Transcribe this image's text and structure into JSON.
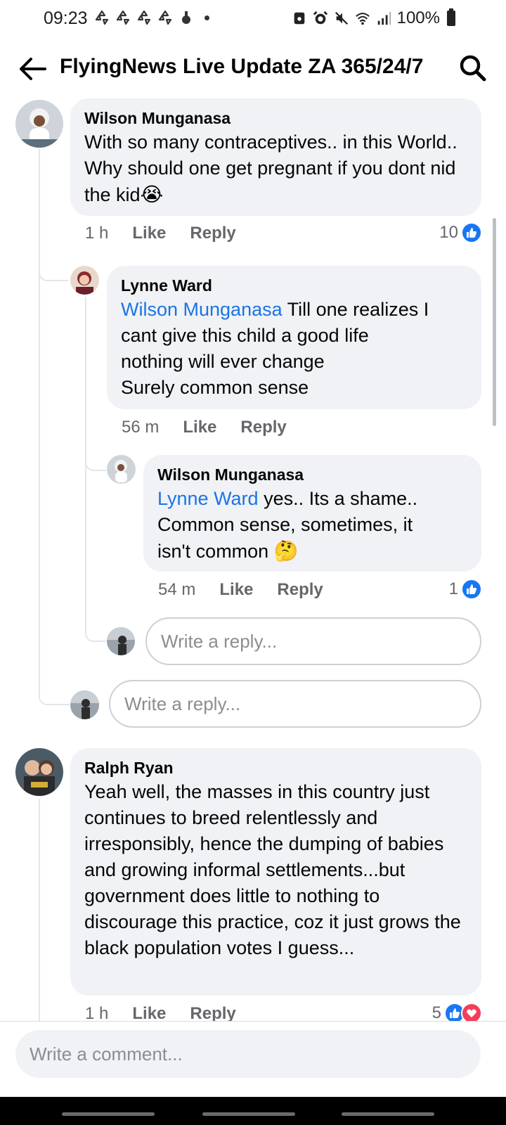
{
  "status_bar": {
    "time": "09:23",
    "battery": "100%",
    "notification_icons": [
      "recycle-icon",
      "recycle-icon",
      "recycle-icon",
      "recycle-icon",
      "app-icon"
    ]
  },
  "header": {
    "title": "FlyingNews Live Update ZA 365/24/7"
  },
  "comments": [
    {
      "author": "Wilson Munganasa",
      "text": "With so many contraceptives.. in this World.. Why should one get pregnant if you dont nid the kid",
      "emoji": "😭",
      "time": "1 h",
      "like_label": "Like",
      "reply_label": "Reply",
      "reaction_count": "10"
    },
    {
      "author": "Lynne Ward",
      "mention": "Wilson Munganasa",
      "text_line1": " Till one realizes I",
      "text_line2": "cant give this child a good life",
      "text_line3": "nothing will ever change",
      "text_line4": "Surely common sense",
      "time": "56 m",
      "like_label": "Like",
      "reply_label": "Reply"
    },
    {
      "author": "Wilson Munganasa",
      "mention": "Lynne Ward",
      "text_line1": " yes.. Its a shame..",
      "text_line2": "Common sense, sometimes, it",
      "text_line3": "isn't common ",
      "emoji": "🤔",
      "time": "54 m",
      "like_label": "Like",
      "reply_label": "Reply",
      "reaction_count": "1"
    },
    {
      "author": "Ralph Ryan",
      "text": "Yeah well, the masses in this country just continues to breed relentlessly and irresponsibly, hence the dumping of babies and growing informal settlements...but government does little to nothing to discourage this practice, coz it just grows the black population votes I guess...",
      "time": "1 h",
      "like_label": "Like",
      "reply_label": "Reply",
      "reaction_count": "5"
    }
  ],
  "reply_placeholder": "Write a reply...",
  "comment_placeholder": "Write a comment...",
  "colors": {
    "accent": "#1877f2",
    "mention": "#1b74e4",
    "bubble": "#f0f2f5",
    "love": "#f33e58"
  }
}
